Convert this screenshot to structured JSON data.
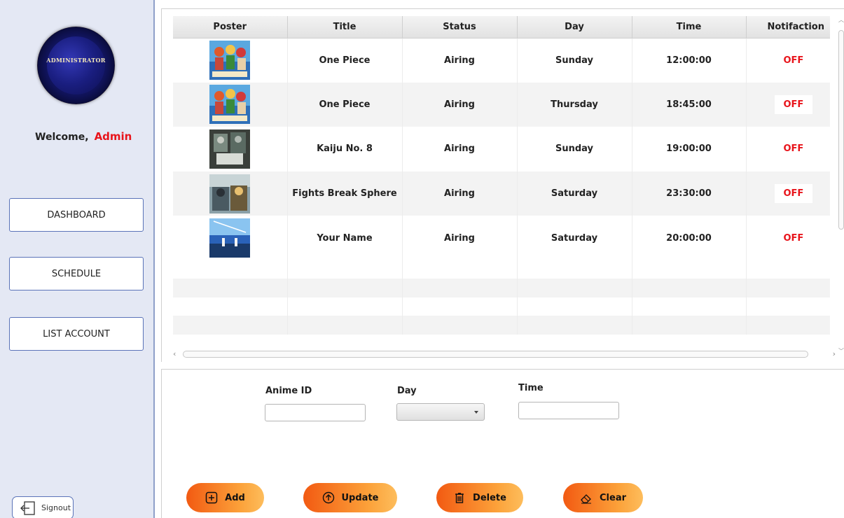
{
  "sidebar": {
    "avatar_text": "ADMINISTRATOR",
    "welcome_label": "Welcome,",
    "user_name": "Admin",
    "nav": [
      {
        "label": "DASHBOARD"
      },
      {
        "label": "SCHEDULE"
      },
      {
        "label": "LIST ACCOUNT"
      }
    ],
    "signout_label": "Signout"
  },
  "table": {
    "columns": [
      "Poster",
      "Title",
      "Status",
      "Day",
      "Time",
      "Notifaction"
    ],
    "rows": [
      {
        "poster": "one-piece-poster",
        "title": "One Piece",
        "status": "Airing",
        "day": "Sunday",
        "time": "12:00:00",
        "notification": "OFF"
      },
      {
        "poster": "one-piece-poster",
        "title": "One Piece",
        "status": "Airing",
        "day": "Thursday",
        "time": "18:45:00",
        "notification": "OFF"
      },
      {
        "poster": "kaiju-no-8-poster",
        "title": "Kaiju No. 8",
        "status": "Airing",
        "day": "Sunday",
        "time": "19:00:00",
        "notification": "OFF"
      },
      {
        "poster": "fights-break-sphere-poster",
        "title": "Fights Break Sphere",
        "status": "Airing",
        "day": "Saturday",
        "time": "23:30:00",
        "notification": "OFF"
      },
      {
        "poster": "your-name-poster",
        "title": "Your Name",
        "status": "Airing",
        "day": "Saturday",
        "time": "20:00:00",
        "notification": "OFF"
      }
    ]
  },
  "form": {
    "anime_id_label": "Anime ID",
    "anime_id_value": "",
    "day_label": "Day",
    "day_value": "",
    "time_label": "Time",
    "time_value": ""
  },
  "actions": {
    "add_label": "Add",
    "update_label": "Update",
    "delete_label": "Delete",
    "clear_label": "Clear"
  },
  "colors": {
    "accent_red": "#e8141b",
    "sidebar_bg": "#e4e8f4",
    "button_gradient_start": "#f25a12",
    "button_gradient_end": "#fdbd5c"
  }
}
